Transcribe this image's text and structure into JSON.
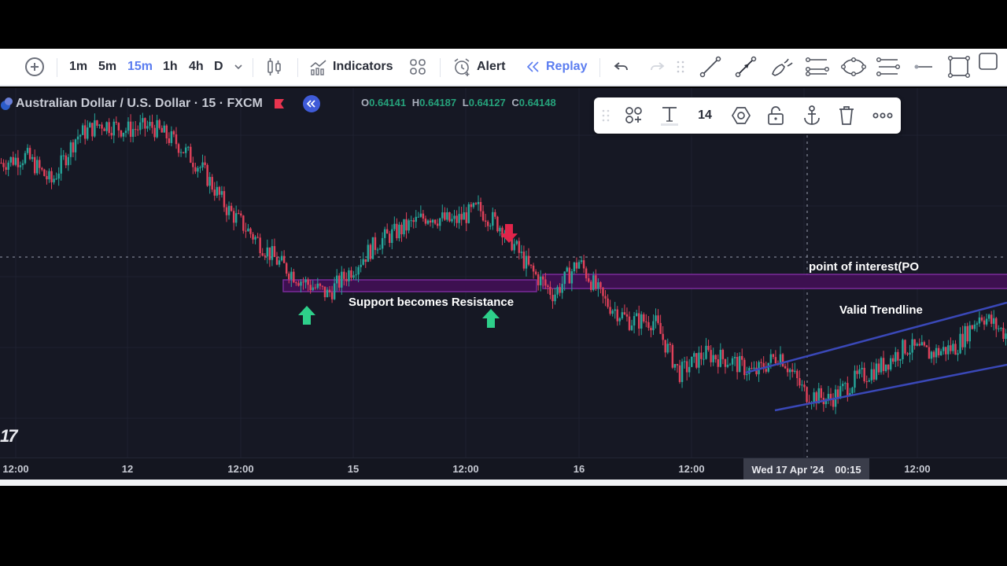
{
  "toolbar": {
    "timeframes": [
      {
        "label": "1m",
        "active": false
      },
      {
        "label": "5m",
        "active": false
      },
      {
        "label": "15m",
        "active": true
      },
      {
        "label": "1h",
        "active": false
      },
      {
        "label": "4h",
        "active": false
      },
      {
        "label": "D",
        "active": false
      }
    ],
    "indicators_label": "Indicators",
    "alert_label": "Alert",
    "replay_label": "Replay",
    "drawing_tools": [
      "trend-line",
      "ray",
      "brush",
      "parallel-channel",
      "ellipse",
      "fib-channel",
      "horizontal-ray",
      "rectangle",
      "square"
    ]
  },
  "symbol": {
    "title": "Australian Dollar / U.S. Dollar · 15 · FXCM",
    "ohlc": {
      "open_key": "O",
      "open": "0.64141",
      "high_key": "H",
      "high": "0.64187",
      "low_key": "L",
      "low": "0.64127",
      "close_key": "C",
      "close": "0.64148"
    }
  },
  "floating_toolbar": {
    "font_size": "14",
    "tools": [
      "template",
      "text-color",
      "font-size",
      "settings",
      "lock",
      "anchor",
      "delete",
      "more"
    ]
  },
  "annotations": {
    "support_resistance": "Support becomes Resistance",
    "poi": "point of interest(PO",
    "trendline": "Valid Trendline"
  },
  "time_axis": {
    "ticks": [
      "12:00",
      "12",
      "12:00",
      "15",
      "12:00",
      "16",
      "12:00",
      "12:00"
    ],
    "crosshair_date": "Wed 17 Apr '24",
    "crosshair_time": "00:15"
  },
  "colors": {
    "bull": "#26a69a",
    "bear": "#e0415a",
    "zone": "#6a1b8a",
    "trend": "#3a48b8",
    "accent": "#5b7df0"
  },
  "chart_data": {
    "type": "candlestick",
    "symbol": "AUDUSD",
    "interval": "15",
    "x_ticks": [
      "12:00",
      "12",
      "12:00",
      "15",
      "12:00",
      "16",
      "12:00",
      "Wed 17 Apr '24 00:15",
      "12:00"
    ],
    "price_path": [
      0.646,
      0.6462,
      0.6454,
      0.6468,
      0.6472,
      0.647,
      0.6471,
      0.6466,
      0.6458,
      0.6446,
      0.6438,
      0.643,
      0.6424,
      0.642,
      0.6428,
      0.6436,
      0.644,
      0.6444,
      0.6442,
      0.6446,
      0.644,
      0.6428,
      0.642,
      0.643,
      0.6418,
      0.6412,
      0.6412,
      0.6396,
      0.6402,
      0.64,
      0.6396,
      0.6402,
      0.639,
      0.6388,
      0.6394,
      0.6398,
      0.6404,
      0.6402,
      0.6404,
      0.6414,
      0.6408
    ]
  }
}
